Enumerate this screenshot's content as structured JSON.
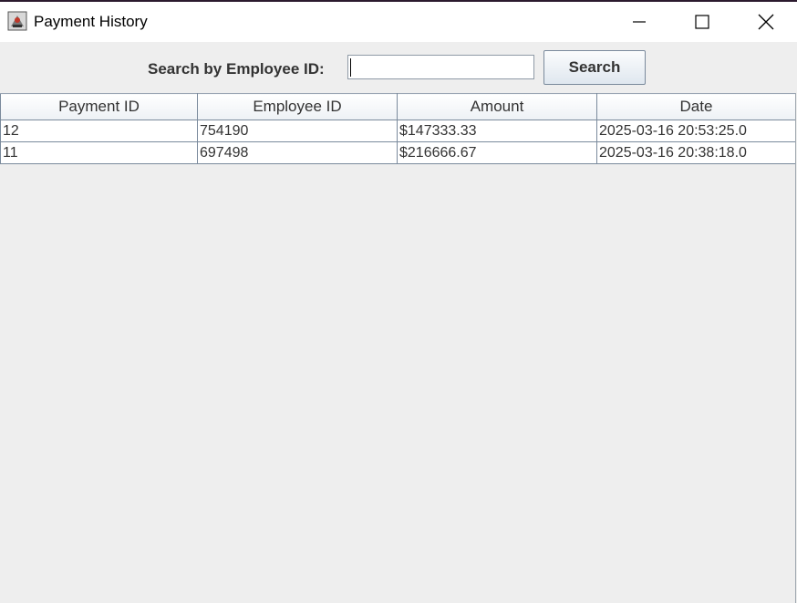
{
  "window": {
    "title": "Payment History",
    "icon": "java-app-icon",
    "controls": {
      "minimize": "minimize-icon",
      "maximize": "maximize-icon",
      "close": "close-icon"
    }
  },
  "search": {
    "label": "Search by Employee ID:",
    "input_value": "",
    "button_label": "Search"
  },
  "table": {
    "columns": [
      "Payment ID",
      "Employee ID",
      "Amount",
      "Date"
    ],
    "rows": [
      [
        "12",
        "754190",
        "$147333.33",
        "2025-03-16 20:53:25.0"
      ],
      [
        "11",
        "697498",
        "$216666.67",
        "2025-03-16 20:38:18.0"
      ]
    ]
  },
  "colors": {
    "background": "#eeeeee",
    "titlebar": "#ffffff",
    "grid": "#7a8a9c",
    "text": "#333333"
  }
}
